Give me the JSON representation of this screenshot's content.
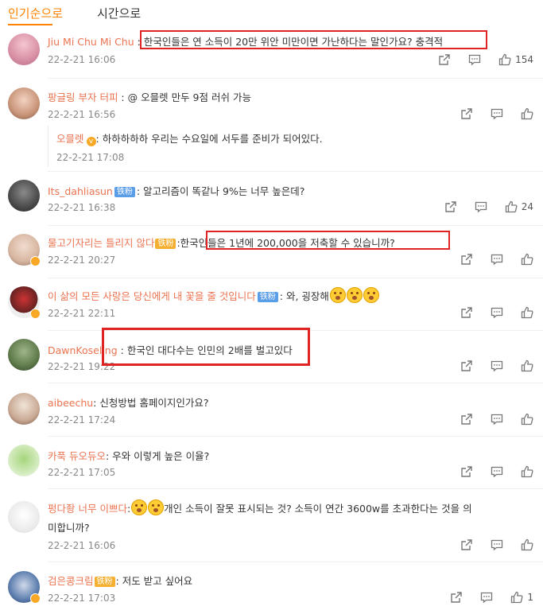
{
  "tabs": {
    "active": "인기순으로",
    "inactive": "시간으로"
  },
  "comments": [
    {
      "user": "Jiu Mi Chu Mi Chu",
      "sep": " : ",
      "text": "한국인들은 연 소득이 20만 위안 미만이면 가난하다는 말인가요? 충격적",
      "date": "22-2-21 16:06",
      "likes": "154"
    },
    {
      "user": "팡글링 부자 터피",
      "sep": " : ",
      "text": "@ 오믈렛 만두 9점 러쉬 가능",
      "date": "22-2-21 16:56",
      "likes": "",
      "reply": {
        "user": "오믈렛",
        "text": ": 하하하하하 우리는 수요일에 서두를 준비가 되어있다.",
        "date": "22-2-21 17:08"
      }
    },
    {
      "user": "Its_dahliasun",
      "tag": "铁粉",
      "text": ": 알고리즘이 똑같나 9%는 너무 높은데?",
      "date": "22-2-21 16:38",
      "likes": "24"
    },
    {
      "user": "물고기자리는 틀리지 않다",
      "tag": "铁粉",
      "text": "한국인들은 1년에 200,000을 저축할 수 있습니까?",
      "date": "22-2-21 20:27",
      "likes": ""
    },
    {
      "user": "이 삶의 모든 사랑은 당신에게 내 꽃을 줄 것입니다",
      "tag": "铁粉",
      "text": ": 와, 굉장해",
      "date": "22-2-21 22:11",
      "likes": ""
    },
    {
      "user": "DawnKoseling",
      "text": "한국인 대다수는 인민의 2배를 벌고있다",
      "date": "22-2-21 19:22",
      "likes": ""
    },
    {
      "user": "aibeechu",
      "text": ": 신청방법 홈페이지인가요?",
      "date": "22-2-21 17:24",
      "likes": ""
    },
    {
      "user": "카푹 듀오듀오",
      "text": ": 우와 이렇게 높은 이율?",
      "date": "22-2-21 17:05",
      "likes": ""
    },
    {
      "user": "펑다좡 너무 이쁘다",
      "text": "개인 소득이 잘못 표시되는 것? 소득이 연간 3600w를 초과한다는 것을 의",
      "text2": "미합니까?",
      "date": "22-2-21 16:06",
      "likes": ""
    },
    {
      "user": "검은콩크림",
      "tag": "铁粉",
      "text": ": 저도 받고 싶어요",
      "date": "22-2-21 17:03",
      "likes": "1"
    }
  ],
  "icons": [
    "share-icon",
    "comment-icon",
    "like-icon"
  ],
  "colors": {
    "accent": "#ff8200",
    "username": "#eb7350",
    "highlight_box": "#e02424",
    "fan_tag": "#5b9ee8"
  }
}
